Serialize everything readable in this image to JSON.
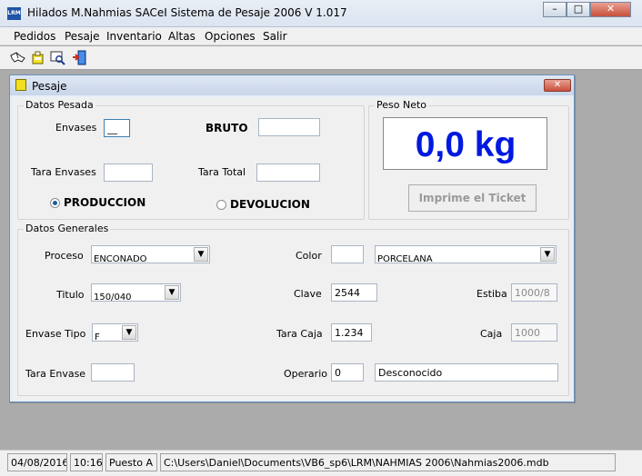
{
  "app": {
    "logo": "LRM",
    "title": "Hilados M.Nahmias SACeI   Sistema de Pesaje 2006    V 1.017"
  },
  "window_controls": {
    "minimize": "–",
    "maximize": "□",
    "close": "✕"
  },
  "menu": [
    "Pedidos",
    "Pesaje",
    "Inventario",
    "Altas",
    "Opciones",
    "Salir"
  ],
  "toolbar_icons": [
    "handshake-icon",
    "scale-icon",
    "search-document-icon",
    "exit-door-icon"
  ],
  "child_window": {
    "title": "Pesaje",
    "close": "✕",
    "datos_pesada": {
      "legend": "Datos Pesada",
      "envases_label": "Envases",
      "envases_value": "__",
      "bruto_label": "BRUTO",
      "bruto_value": "",
      "tara_envases_label": "Tara Envases",
      "tara_envases_value": "",
      "tara_total_label": "Tara Total",
      "tara_total_value": "",
      "produccion_label": "PRODUCCION",
      "devolucion_label": "DEVOLUCION",
      "selected": "PRODUCCION"
    },
    "peso_neto": {
      "legend": "Peso Neto",
      "value": "0,0 kg",
      "print_button": "Imprime el Ticket"
    },
    "datos_generales": {
      "legend": "Datos Generales",
      "proceso_label": "Proceso",
      "proceso_value": "ENCONADO",
      "color_label": "Color",
      "color_code": "",
      "color_value": "PORCELANA",
      "titulo_label": "Titulo",
      "titulo_value": "150/040",
      "clave_label": "Clave",
      "clave_value": "2544",
      "estiba_label": "Estiba",
      "estiba_value": "1000/8",
      "envase_tipo_label": "Envase Tipo",
      "envase_tipo_value": "F",
      "tara_caja_label": "Tara Caja",
      "tara_caja_value": "1.234",
      "caja_label": "Caja",
      "caja_value": "1000",
      "tara_envase_label": "Tara Envase",
      "tara_envase_value": "",
      "operario_label": "Operario",
      "operario_id": "0",
      "operario_name": "Desconocido"
    }
  },
  "status": {
    "date": "04/08/2016",
    "time": "10:16",
    "puesto": "Puesto  A",
    "path": "C:\\Users\\Daniel\\Documents\\VB6_sp6\\LRM\\NAHMIAS 2006\\Nahmias2006.mdb"
  },
  "colors": {
    "peso": "#0018e0",
    "accent": "#1e5aa0"
  }
}
